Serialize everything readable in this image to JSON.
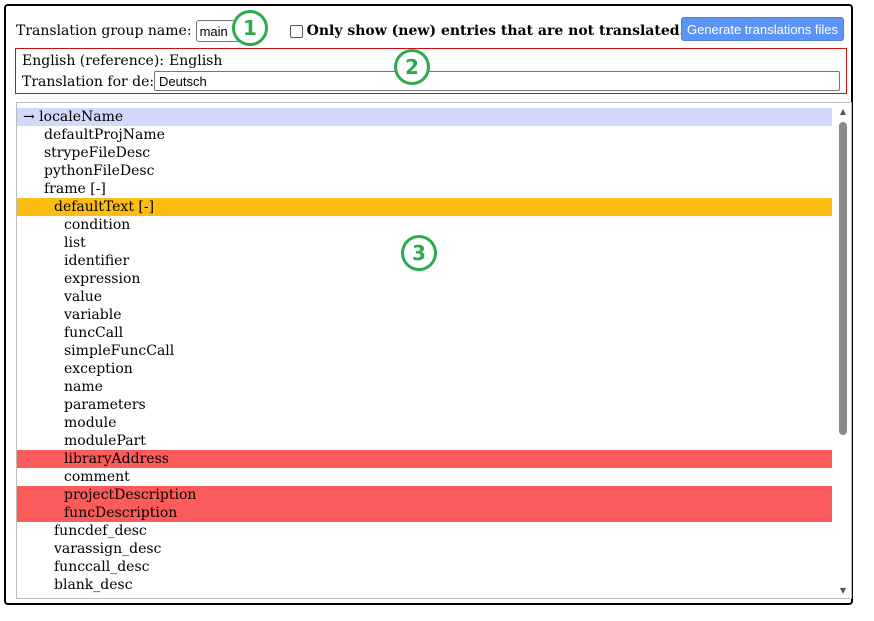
{
  "toolbar": {
    "group_label": "Translation group name:",
    "group_selected": "main",
    "only_untranslated_label": "Only show (new) entries that are not translated.",
    "generate_button": "Generate translations files"
  },
  "reference": {
    "english_label": "English (reference):",
    "english_value": "English",
    "translation_label": "Translation for de:",
    "translation_value": "Deutsch"
  },
  "markers": [
    "1",
    "2",
    "3"
  ],
  "tree": [
    {
      "text": "→ localeName",
      "indent": 0,
      "state": "current"
    },
    {
      "text": "defaultProjName",
      "indent": 1,
      "state": ""
    },
    {
      "text": "strypeFileDesc",
      "indent": 1,
      "state": ""
    },
    {
      "text": "pythonFileDesc",
      "indent": 1,
      "state": ""
    },
    {
      "text": "frame [-]",
      "indent": 1,
      "state": ""
    },
    {
      "text": "defaultText [-]",
      "indent": 2,
      "state": "selected"
    },
    {
      "text": "condition",
      "indent": 3,
      "state": ""
    },
    {
      "text": "list",
      "indent": 3,
      "state": ""
    },
    {
      "text": "identifier",
      "indent": 3,
      "state": ""
    },
    {
      "text": "expression",
      "indent": 3,
      "state": ""
    },
    {
      "text": "value",
      "indent": 3,
      "state": ""
    },
    {
      "text": "variable",
      "indent": 3,
      "state": ""
    },
    {
      "text": "funcCall",
      "indent": 3,
      "state": ""
    },
    {
      "text": "simpleFuncCall",
      "indent": 3,
      "state": ""
    },
    {
      "text": "exception",
      "indent": 3,
      "state": ""
    },
    {
      "text": "name",
      "indent": 3,
      "state": ""
    },
    {
      "text": "parameters",
      "indent": 3,
      "state": ""
    },
    {
      "text": "module",
      "indent": 3,
      "state": ""
    },
    {
      "text": "modulePart",
      "indent": 3,
      "state": ""
    },
    {
      "text": "libraryAddress",
      "indent": 3,
      "state": "untranslated"
    },
    {
      "text": "comment",
      "indent": 3,
      "state": ""
    },
    {
      "text": "projectDescription",
      "indent": 3,
      "state": "untranslated"
    },
    {
      "text": "funcDescription",
      "indent": 3,
      "state": "untranslated"
    },
    {
      "text": "funcdef_desc",
      "indent": 2,
      "state": ""
    },
    {
      "text": "varassign_desc",
      "indent": 2,
      "state": ""
    },
    {
      "text": "funccall_desc",
      "indent": 2,
      "state": ""
    },
    {
      "text": "blank_desc",
      "indent": 2,
      "state": ""
    }
  ],
  "colors": {
    "current_row": "#d3d9fb",
    "selected_row": "#fbbd12",
    "untranslated_row": "#fc5b5b",
    "button": "#5b94f5",
    "marker": "#2cab4c"
  },
  "icons": {
    "select_chevron": "chevron-down-icon",
    "scroll_up": "arrow-up-icon",
    "scroll_down": "arrow-down-icon"
  }
}
